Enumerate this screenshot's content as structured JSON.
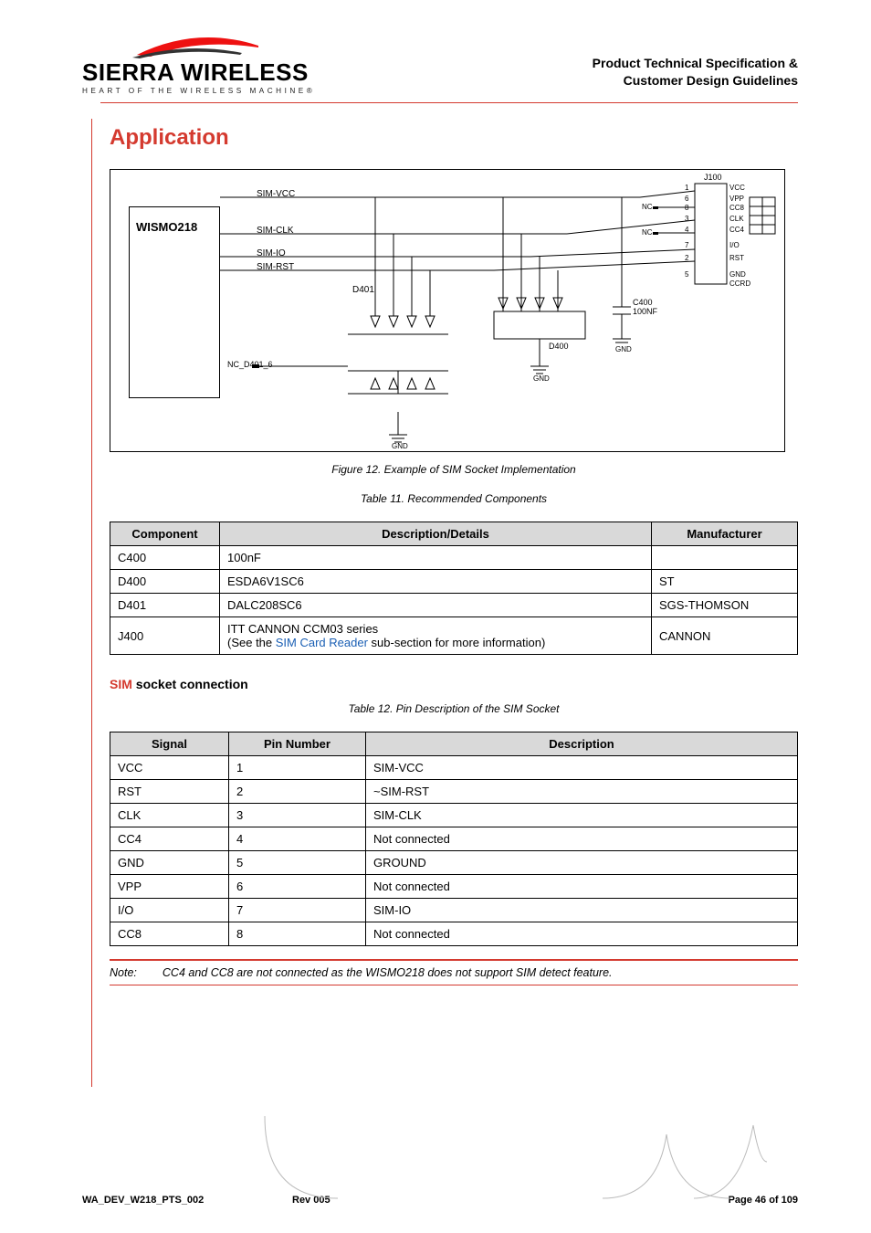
{
  "header": {
    "brand_top": "SIERRA",
    "brand_bottom": "WIRELESS",
    "tagline": "HEART OF THE WIRELESS MACHINE®",
    "doc_title_1": "Product Technical Specification &",
    "doc_title_2": "Customer Design Guidelines"
  },
  "section_title": "Application",
  "figure": {
    "wismo": "WISMO218",
    "sig_vcc": "SIM-VCC",
    "sig_clk": "SIM-CLK",
    "sig_io": "SIM-IO",
    "sig_rst": "SIM-RST",
    "d401": "D401",
    "nc_d401": "NC_D401_6",
    "d400": "D400",
    "c400": "C400",
    "c400v": "100NF",
    "gnd": "GND",
    "j100": "J100",
    "nc": "NC",
    "p1": "1",
    "p2": "2",
    "p3": "3",
    "p4": "4",
    "p5": "5",
    "p6": "6",
    "p7": "7",
    "p8": "8",
    "pvcc": "VCC",
    "pvpp": "VPP",
    "pcc8": "CC8",
    "pclk": "CLK",
    "pcc4": "CC4",
    "pio": "I/O",
    "prst": "RST",
    "pgnd": "GND",
    "pccrd": "CCRD"
  },
  "fig_caption": "Figure 12. Example of SIM Socket Implementation",
  "table11": {
    "caption": "Table 11.    Recommended Components",
    "headers": {
      "comp": "Component",
      "desc": "Description/Details",
      "manu": "Manufacturer"
    },
    "rows": [
      {
        "comp": "C400",
        "desc": "100nF",
        "manu": ""
      },
      {
        "comp": "D400",
        "desc": "ESDA6V1SC6",
        "manu": "ST"
      },
      {
        "comp": "D401",
        "desc": "DALC208SC6",
        "manu": "SGS-THOMSON"
      }
    ],
    "j400": {
      "comp": "J400",
      "desc_line1": "ITT CANNON CCM03 series",
      "desc_line2_pre": "(See the ",
      "desc_line2_link": "SIM Card Reader",
      "desc_line2_post": " sub-section for more information)",
      "manu": "CANNON"
    }
  },
  "subhead": {
    "red": "SIM",
    "rest": " socket connection"
  },
  "table12": {
    "caption": "Table 12.    Pin Description of the SIM Socket",
    "headers": {
      "sig": "Signal",
      "pin": "Pin Number",
      "desc": "Description"
    },
    "rows": [
      {
        "sig": "VCC",
        "pin": "1",
        "desc": "SIM-VCC"
      },
      {
        "sig": "RST",
        "pin": "2",
        "desc": "~SIM-RST"
      },
      {
        "sig": "CLK",
        "pin": "3",
        "desc": "SIM-CLK"
      },
      {
        "sig": "CC4",
        "pin": "4",
        "desc": "Not connected"
      },
      {
        "sig": "GND",
        "pin": "5",
        "desc": "GROUND"
      },
      {
        "sig": "VPP",
        "pin": "6",
        "desc": "Not connected"
      },
      {
        "sig": "I/O",
        "pin": "7",
        "desc": "SIM-IO"
      },
      {
        "sig": "CC8",
        "pin": "8",
        "desc": "Not connected"
      }
    ]
  },
  "note": {
    "label": "Note:",
    "text": "CC4 and CC8 are not connected as the WISMO218 does not support SIM detect feature."
  },
  "footer": {
    "left": "WA_DEV_W218_PTS_002",
    "mid": "Rev 005",
    "right": "Page 46 of 109"
  }
}
